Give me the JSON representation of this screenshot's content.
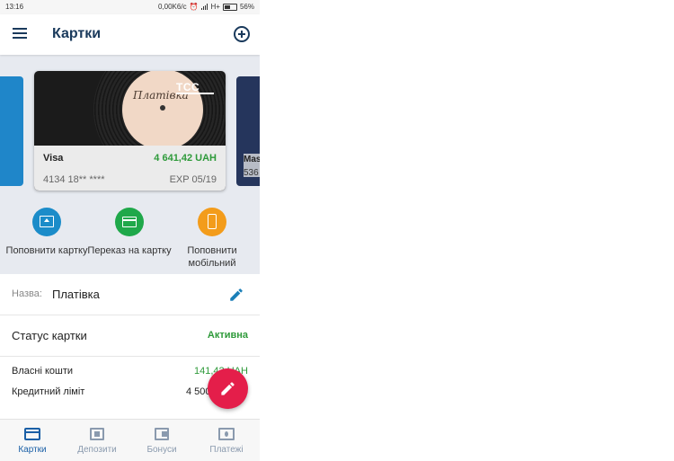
{
  "status_bar": {
    "time": "13:16",
    "speed": "0,00K6/c",
    "network": "H+",
    "battery": "56%"
  },
  "app_bar": {
    "title": "Картки",
    "menu_icon": "hamburger-menu-icon",
    "add_icon": "add-circle-icon"
  },
  "card": {
    "bank_logo": "TCC",
    "type": "Visa",
    "balance": "4 641,42 UAH",
    "number": "4134 18** ****",
    "expiry": "EXP 05/19"
  },
  "next_card": {
    "title": "Mas",
    "number": "536"
  },
  "actions": [
    {
      "label": "Поповнити картку",
      "icon": "topup-icon",
      "color": "#1b8cc9"
    },
    {
      "label": "Переказ на картку",
      "icon": "card-transfer-icon",
      "color": "#1fa84a"
    },
    {
      "label": "Поповнити мобільний",
      "icon": "mobile-phone-icon",
      "color": "#f39c1b"
    }
  ],
  "details": {
    "name_label": "Назва:",
    "name_value": "Платівка",
    "status_label": "Статус картки",
    "status_value": "Активна",
    "own_funds_label": "Власні кошти",
    "own_funds_value": "141,42 UAH",
    "credit_limit_label": "Кредитний ліміт",
    "credit_limit_value": "4 500"
  },
  "bottom_nav": [
    {
      "label": "Картки",
      "active": true
    },
    {
      "label": "Депозити",
      "active": false
    },
    {
      "label": "Бонуси",
      "active": false
    },
    {
      "label": "Платежі",
      "active": false
    }
  ],
  "colors": {
    "accent": "#1a3a5c",
    "active_tab": "#1a5fa6",
    "positive": "#2e9a3a",
    "fab": "#e41e4a"
  }
}
